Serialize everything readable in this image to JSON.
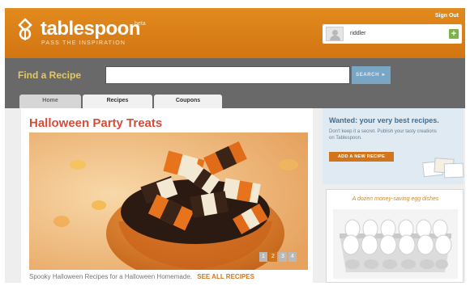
{
  "header": {
    "logo_text": "tablespoon",
    "logo_beta": "beta",
    "tagline": "PASS THE INSPIRATION",
    "sign_out": "Sign Out",
    "username": "riddler"
  },
  "search": {
    "label": "Find a Recipe",
    "value": "",
    "button": "SEARCH"
  },
  "tabs": [
    {
      "label": "Home",
      "active": true
    },
    {
      "label": "Recipes",
      "active": false
    },
    {
      "label": "Coupons",
      "active": false
    }
  ],
  "feature": {
    "title": "Halloween Party Treats",
    "caption": "Spooky Halloween Recipes for a Halloween Homemade.",
    "see_all": "SEE ALL RECIPES",
    "pages": [
      "1",
      "2",
      "3",
      "4"
    ],
    "active_page": "2"
  },
  "wanted": {
    "title": "Wanted: your very best recipes.",
    "text": "Don't keep it a secret. Publish your tasty creations on Tablespoon.",
    "button": "ADD A NEW RECIPE"
  },
  "egg_ad": {
    "title": "A dozen money-saving egg dishes"
  },
  "colors": {
    "brand_orange": "#d2741c",
    "title_red": "#d44d3a",
    "search_blue": "#7aa6c6",
    "find_yellow": "#e6c95c"
  }
}
